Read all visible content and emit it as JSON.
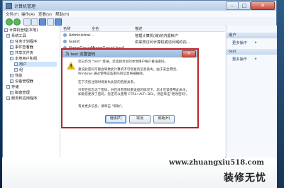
{
  "window": {
    "title": "计算机管理"
  },
  "menubar": [
    "文件(F)",
    "操作(A)",
    "查看(V)",
    "帮助(H)"
  ],
  "tree": [
    "计算机管理(本地)",
    "系统工具",
    "任务计划程序",
    "事件查看器",
    "共享文件夹",
    "本地用户和组",
    "用户",
    "组",
    "性能",
    "设备管理器",
    "存储",
    "磁盘管理",
    "服务和应用程序"
  ],
  "list": {
    "headers": [
      "名称",
      "全名",
      "描述"
    ],
    "rows": [
      {
        "name": "Administrat...",
        "fullname": "",
        "desc": "管理计算机(域)的内置帐户"
      },
      {
        "name": "Guest",
        "fullname": "",
        "desc": "供来宾访问计算机或访问域的内..."
      },
      {
        "name": "HomeGroupU...",
        "fullname": "HomeGroupUser$",
        "desc": ""
      }
    ]
  },
  "actions": {
    "sections": [
      {
        "header": "用户",
        "item": "更多操作"
      },
      {
        "header": "test",
        "item": "更多操作"
      }
    ]
  },
  "dialog": {
    "title": "为 test 设置密码",
    "close_glyph": "✕",
    "paragraphs": [
      "您已作为 \"test\" 登录，您选择为您的本地用户帐户重设密码。",
      "重设此密码可能会导致此计算机不可恢复的信息丢失。由于安全原因，Windows 通过使用这些密码的信息将被删除。",
      "在下次您注销时将丢失此前的链接关系。",
      "只有在您忘记了密码，并且没有密码重设盘的情况下，您才应该使用此命令。如果您更改了密码，您还可以使用 CTRL+ALT+DEL，然后单击\"更改密码\"。",
      "有关更多信息，请单击 \"帮助\"。"
    ],
    "buttons": [
      "继续(P)",
      "取消",
      "帮助(H)"
    ]
  },
  "watermark": {
    "url": "www.zhuangxiu518.com",
    "brand": "装修无忧"
  }
}
